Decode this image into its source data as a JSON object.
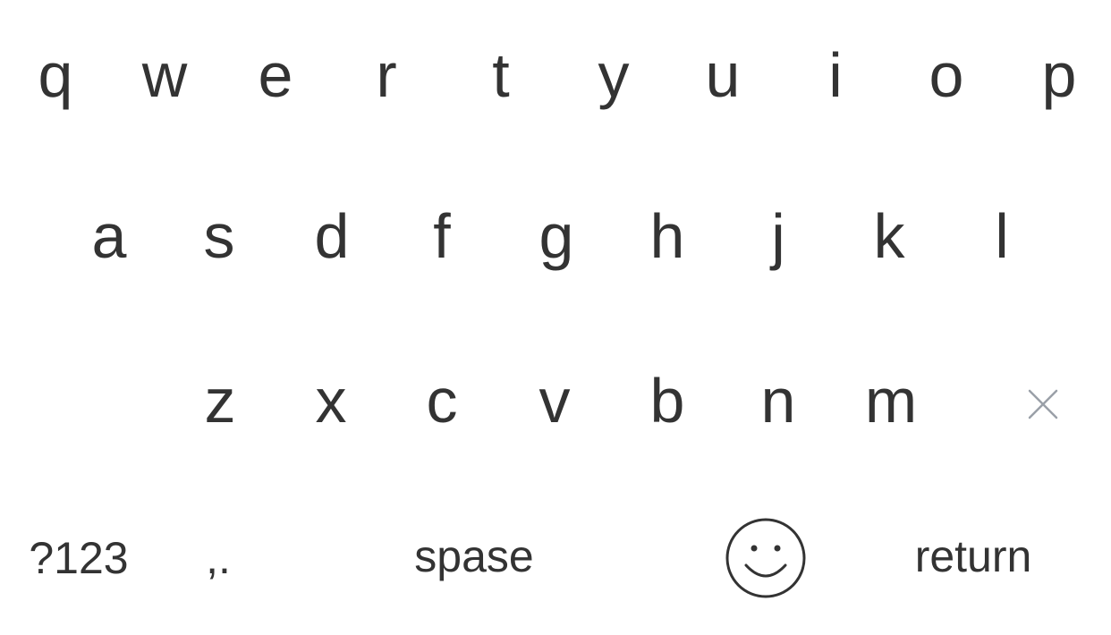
{
  "keyboard": {
    "row1": [
      "q",
      "w",
      "e",
      "r",
      "t",
      "y",
      "u",
      "i",
      "o",
      "p"
    ],
    "row2": [
      "a",
      "s",
      "d",
      "f",
      "g",
      "h",
      "j",
      "k",
      "l"
    ],
    "row3": [
      "z",
      "x",
      "c",
      "v",
      "b",
      "n",
      "m"
    ],
    "bottom": {
      "symbols_label": "?123",
      "punctuation_label": ",.",
      "space_label": "spase",
      "return_label": "return"
    },
    "icons": {
      "backspace": "close-icon",
      "emoji": "smiley-icon"
    },
    "colors": {
      "text": "#333333",
      "backspace": "#9aa0a8",
      "background": "#ffffff"
    }
  }
}
